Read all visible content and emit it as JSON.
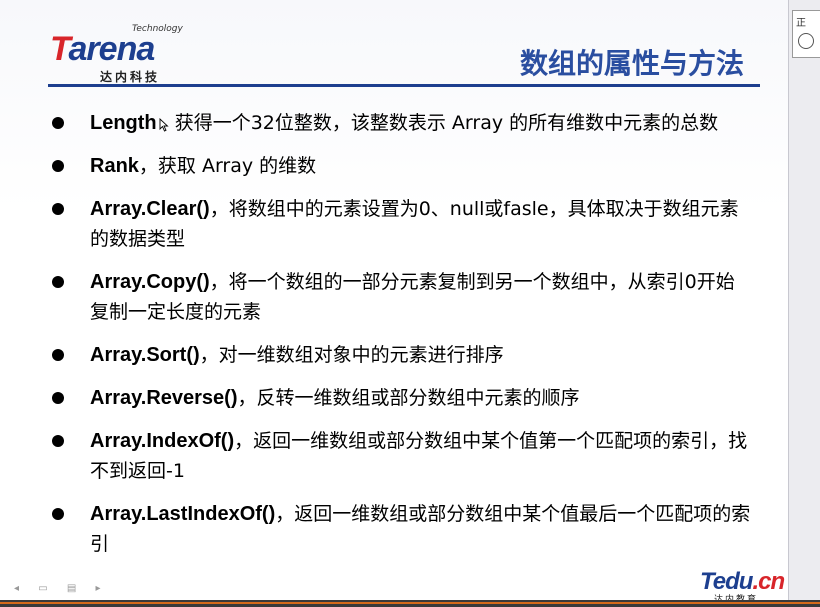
{
  "header": {
    "logo_small": "Technology",
    "logo_main_t": "T",
    "logo_main_rest": "arena",
    "logo_sub": "达内科技",
    "title": "数组的属性与方法"
  },
  "bullets": [
    {
      "bold": "Length",
      "text": "获得一个32位整数，该整数表示 Array 的所有维数中元素的总数"
    },
    {
      "bold": "Rank",
      "text": "，获取 Array 的维数"
    },
    {
      "bold": "Array.Clear()",
      "text": "，将数组中的元素设置为0、null或fasle，具体取决于数组元素的数据类型"
    },
    {
      "bold": "Array.Copy()",
      "text": "，将一个数组的一部分元素复制到另一个数组中，从索引0开始复制一定长度的元素"
    },
    {
      "bold": "Array.Sort()",
      "text": "，对一维数组对象中的元素进行排序"
    },
    {
      "bold": "Array.Reverse()",
      "text": "，反转一维数组或部分数组中元素的顺序"
    },
    {
      "bold": "Array.IndexOf()",
      "text": "，返回一维数组或部分数组中某个值第一个匹配项的索引，找不到返回-1"
    },
    {
      "bold": "Array.LastIndexOf()",
      "text": "，返回一维数组或部分数组中某个值最后一个匹配项的索引"
    }
  ],
  "footer": {
    "logo_main": "Tedu",
    "logo_dot": ".cn",
    "logo_sub": "达内教育"
  },
  "side": {
    "label": "正"
  }
}
